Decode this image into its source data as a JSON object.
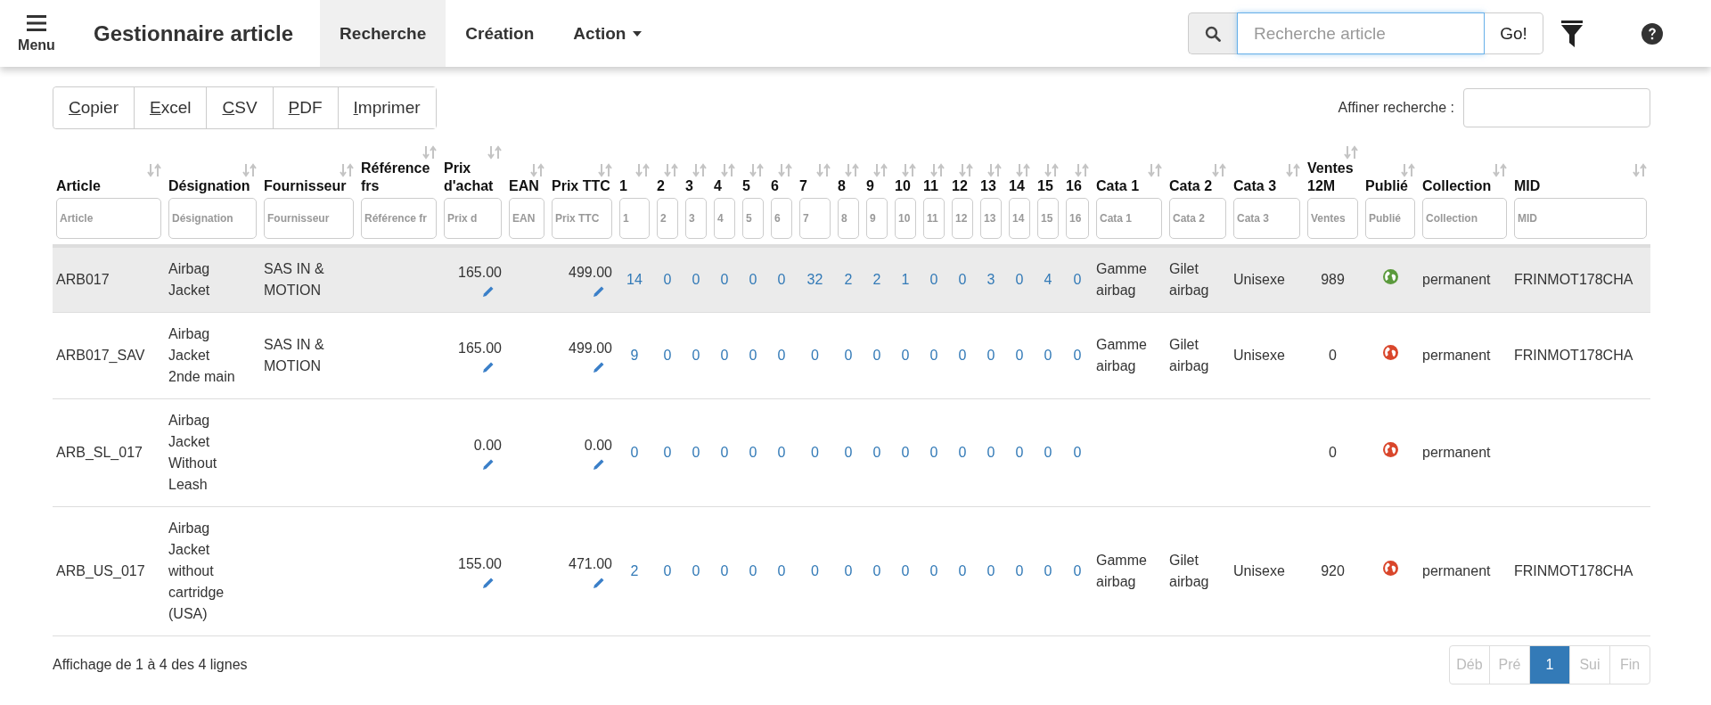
{
  "navbar": {
    "menu_label": "Menu",
    "title": "Gestionnaire article",
    "tabs": [
      {
        "label": "Recherche",
        "selected": true,
        "dropdown": false
      },
      {
        "label": "Création",
        "selected": false,
        "dropdown": false
      },
      {
        "label": "Action",
        "selected": false,
        "dropdown": true
      }
    ],
    "search": {
      "placeholder": "Recherche article",
      "button": "Go!"
    }
  },
  "export_buttons": [
    "Copier",
    "Excel",
    "CSV",
    "PDF",
    "Imprimer"
  ],
  "refine": {
    "label": "Affiner recherche :"
  },
  "table": {
    "columns": [
      {
        "label": "Article",
        "placeholder": "Article"
      },
      {
        "label": "Désignation",
        "placeholder": "Désignation"
      },
      {
        "label": "Fournisseur",
        "placeholder": "Fournisseur"
      },
      {
        "label": "Référence frs",
        "placeholder": "Référence fr"
      },
      {
        "label": "Prix d'achat",
        "placeholder": "Prix d"
      },
      {
        "label": "EAN",
        "placeholder": "EAN"
      },
      {
        "label": "Prix TTC",
        "placeholder": "Prix TTC"
      },
      {
        "label": "1",
        "placeholder": "1"
      },
      {
        "label": "2",
        "placeholder": "2"
      },
      {
        "label": "3",
        "placeholder": "3"
      },
      {
        "label": "4",
        "placeholder": "4"
      },
      {
        "label": "5",
        "placeholder": "5"
      },
      {
        "label": "6",
        "placeholder": "6"
      },
      {
        "label": "7",
        "placeholder": "7"
      },
      {
        "label": "8",
        "placeholder": "8"
      },
      {
        "label": "9",
        "placeholder": "9"
      },
      {
        "label": "10",
        "placeholder": "10"
      },
      {
        "label": "11",
        "placeholder": "11"
      },
      {
        "label": "12",
        "placeholder": "12"
      },
      {
        "label": "13",
        "placeholder": "13"
      },
      {
        "label": "14",
        "placeholder": "14"
      },
      {
        "label": "15",
        "placeholder": "15"
      },
      {
        "label": "16",
        "placeholder": "16"
      },
      {
        "label": "Cata 1",
        "placeholder": "Cata 1"
      },
      {
        "label": "Cata 2",
        "placeholder": "Cata 2"
      },
      {
        "label": "Cata 3",
        "placeholder": "Cata 3"
      },
      {
        "label": "Ventes 12M",
        "placeholder": "Ventes"
      },
      {
        "label": "Publié",
        "placeholder": "Publié"
      },
      {
        "label": "Collection",
        "placeholder": "Collection"
      },
      {
        "label": "MID",
        "placeholder": "MID"
      }
    ],
    "rows": [
      {
        "selected": true,
        "article": "ARB017",
        "designation": "Airbag Jacket",
        "supplier": "SAS IN & MOTION",
        "purchase_price": "165.00",
        "price_ttc": "499.00",
        "counts": [
          "14",
          "0",
          "0",
          "0",
          "0",
          "0",
          "32",
          "2",
          "2",
          "1",
          "0",
          "0",
          "3",
          "0",
          "4",
          "0"
        ],
        "cata_1": "Gamme airbag",
        "cata_2": "Gilet airbag",
        "cata_3": "Unisexe",
        "sales_12m": "989",
        "published": true,
        "collection": "permanent",
        "mid": "FRINMOT178CHA"
      },
      {
        "selected": false,
        "article": "ARB017_SAV",
        "designation": "Airbag Jacket 2nde main",
        "supplier": "SAS IN & MOTION",
        "purchase_price": "165.00",
        "price_ttc": "499.00",
        "counts": [
          "9",
          "0",
          "0",
          "0",
          "0",
          "0",
          "0",
          "0",
          "0",
          "0",
          "0",
          "0",
          "0",
          "0",
          "0",
          "0"
        ],
        "cata_1": "Gamme airbag",
        "cata_2": "Gilet airbag",
        "cata_3": "Unisexe",
        "sales_12m": "0",
        "published": false,
        "collection": "permanent",
        "mid": "FRINMOT178CHA"
      },
      {
        "selected": false,
        "article": "ARB_SL_017",
        "designation": "Airbag Jacket Without Leash",
        "purchase_price": "0.00",
        "price_ttc": "0.00",
        "counts": [
          "0",
          "0",
          "0",
          "0",
          "0",
          "0",
          "0",
          "0",
          "0",
          "0",
          "0",
          "0",
          "0",
          "0",
          "0",
          "0"
        ],
        "sales_12m": "0",
        "published": false,
        "collection": "permanent"
      },
      {
        "selected": false,
        "article": "ARB_US_017",
        "designation": "Airbag Jacket without cartridge (USA)",
        "purchase_price": "155.00",
        "price_ttc": "471.00",
        "counts": [
          "2",
          "0",
          "0",
          "0",
          "0",
          "0",
          "0",
          "0",
          "0",
          "0",
          "0",
          "0",
          "0",
          "0",
          "0",
          "0"
        ],
        "cata_1": "Gamme airbag",
        "cata_2": "Gilet airbag",
        "cata_3": "Unisexe",
        "sales_12m": "920",
        "published": false,
        "collection": "permanent",
        "mid": "FRINMOT178CHA"
      }
    ]
  },
  "footer": {
    "info": "Affichage de 1 à 4 des 4 lignes",
    "pagination": [
      {
        "label": "Déb",
        "selected": false,
        "disabled": true
      },
      {
        "label": "Pré",
        "selected": false,
        "disabled": true
      },
      {
        "label": "1",
        "selected": true,
        "disabled": false
      },
      {
        "label": "Sui",
        "selected": false,
        "disabled": true
      },
      {
        "label": "Fin",
        "selected": false,
        "disabled": true
      }
    ]
  }
}
